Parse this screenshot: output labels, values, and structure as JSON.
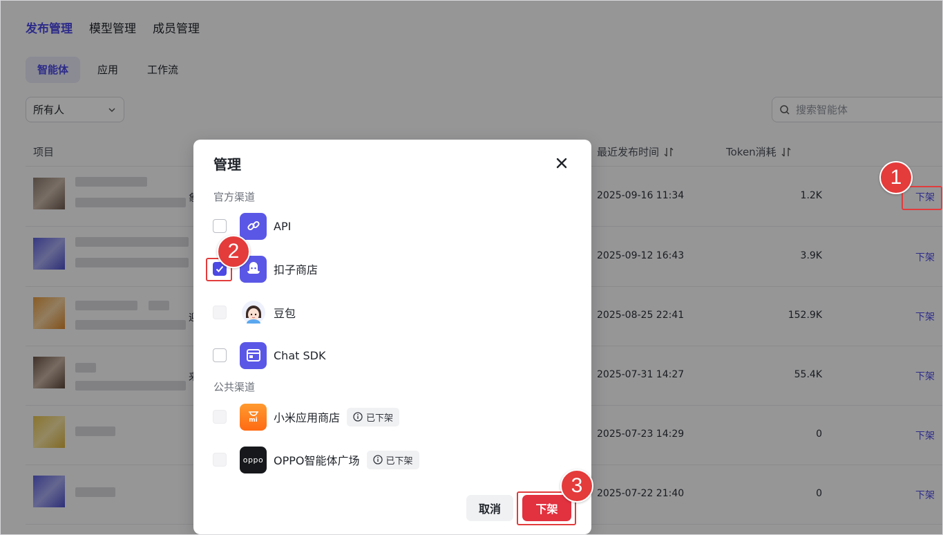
{
  "topnav": [
    "发布管理",
    "模型管理",
    "成员管理"
  ],
  "subtabs": [
    "智能体",
    "应用",
    "工作流"
  ],
  "filter": {
    "owner": "所有人",
    "search_placeholder": "搜索智能体"
  },
  "table": {
    "headers": {
      "project": "项目",
      "last_publish": "最近发布时间",
      "token": "Token消耗"
    },
    "rows": [
      {
        "time": "2025-09-16 11:34",
        "token": "1.2K",
        "action": "下架",
        "trunc": "象"
      },
      {
        "time": "2025-09-12 16:43",
        "token": "3.9K",
        "action": "下架",
        "trunc": ""
      },
      {
        "time": "2025-08-25 22:41",
        "token": "152.9K",
        "action": "下架",
        "trunc": "迎"
      },
      {
        "time": "2025-07-31 14:27",
        "token": "55.4K",
        "action": "下架",
        "trunc": "来"
      },
      {
        "time": "2025-07-23 14:29",
        "token": "0",
        "action": "下架",
        "trunc": ""
      },
      {
        "time": "2025-07-22 21:40",
        "token": "0",
        "action": "下架",
        "trunc": ""
      }
    ]
  },
  "modal": {
    "title": "管理",
    "official_label": "官方渠道",
    "public_label": "公共渠道",
    "official": [
      {
        "name": "API",
        "checked": false,
        "disabled": false,
        "icon": "link-icon"
      },
      {
        "name": "扣子商店",
        "checked": true,
        "disabled": false,
        "icon": "coze-store-icon"
      },
      {
        "name": "豆包",
        "checked": false,
        "disabled": true,
        "icon": "doubao-avatar-icon"
      },
      {
        "name": "Chat SDK",
        "checked": false,
        "disabled": false,
        "icon": "window-icon"
      }
    ],
    "public": [
      {
        "name": "小米应用商店",
        "badge": "已下架",
        "icon": "xiaomi-store-icon",
        "icon_text": "mi"
      },
      {
        "name": "OPPO智能体广场",
        "badge": "已下架",
        "icon": "oppo-icon",
        "icon_text": "oppo"
      }
    ],
    "cancel": "取消",
    "confirm": "下架"
  },
  "steps": [
    "1",
    "2",
    "3"
  ],
  "colors": {
    "accent": "#4c49e4",
    "danger": "#e2313f",
    "annotation": "#e43b3b"
  }
}
